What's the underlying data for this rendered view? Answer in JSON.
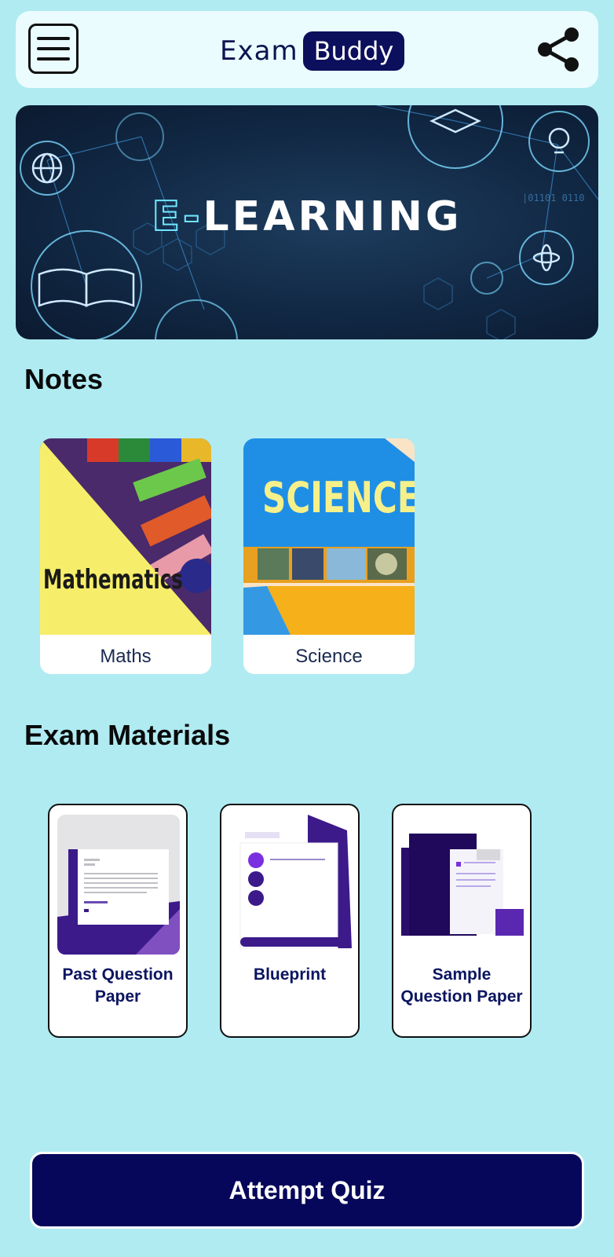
{
  "header": {
    "logo_part1": "Exam",
    "logo_part2": "Buddy"
  },
  "banner": {
    "title_prefix": "E-",
    "title_main": "LEARNING"
  },
  "notes": {
    "title": "Notes",
    "items": [
      {
        "label": "Maths",
        "cover_text": "Mathematics"
      },
      {
        "label": "Science",
        "cover_text": "SCIENCE"
      }
    ]
  },
  "exam_materials": {
    "title": "Exam Materials",
    "items": [
      {
        "label": "Past Question Paper"
      },
      {
        "label": "Blueprint"
      },
      {
        "label": "Sample Question Paper"
      }
    ]
  },
  "quiz_button": {
    "label": "Attempt Quiz"
  },
  "colors": {
    "background": "#b0ebf2",
    "primary": "#06075a",
    "accent": "#5a2bb8"
  }
}
